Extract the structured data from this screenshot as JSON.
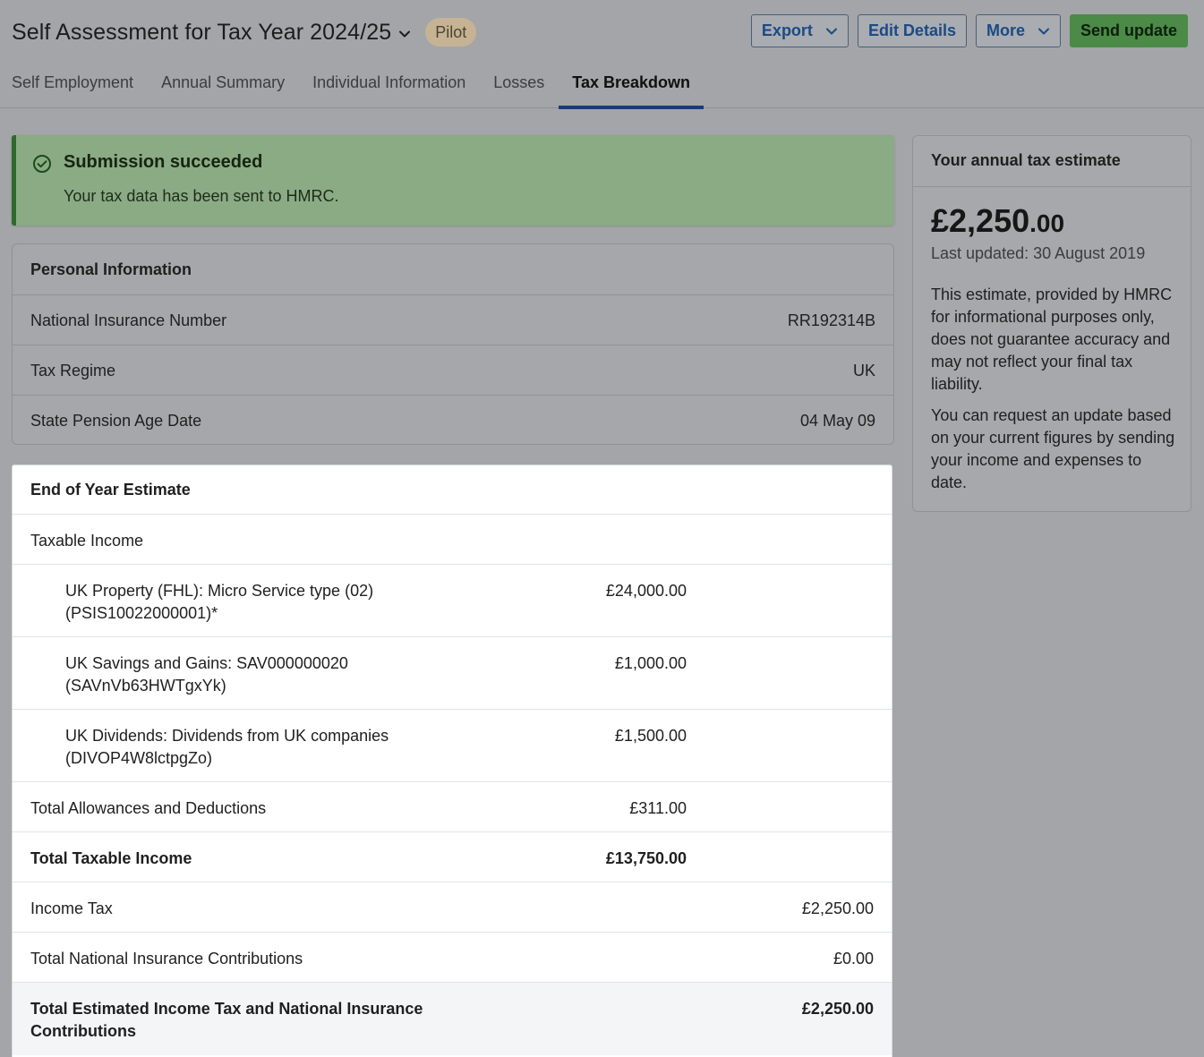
{
  "header": {
    "title": "Self Assessment for Tax Year 2024/25",
    "badge": "Pilot",
    "buttons": {
      "export": "Export",
      "edit_details": "Edit Details",
      "more": "More",
      "send_update": "Send update"
    },
    "tabs": [
      {
        "label": "Self Employment"
      },
      {
        "label": "Annual Summary"
      },
      {
        "label": "Individual Information"
      },
      {
        "label": "Losses"
      },
      {
        "label": "Tax Breakdown",
        "active": true
      }
    ]
  },
  "alert": {
    "title": "Submission succeeded",
    "message": "Your tax data has been sent to HMRC."
  },
  "personal": {
    "heading": "Personal Information",
    "rows": [
      {
        "label": "National Insurance Number",
        "value": "RR192314B"
      },
      {
        "label": "Tax Regime",
        "value": "UK"
      },
      {
        "label": "State Pension Age Date",
        "value": "04 May 09"
      }
    ]
  },
  "estimate": {
    "heading": "End of Year Estimate",
    "taxable_income_label": "Taxable Income",
    "income_items": [
      {
        "label": "UK Property (FHL): Micro Service type (02) (PSIS10022000001)*",
        "value": "£24,000.00"
      },
      {
        "label": "UK Savings and Gains: SAV000000020 (SAVnVb63HWTgxYk)",
        "value": "£1,000.00"
      },
      {
        "label": "UK Dividends: Dividends from UK companies (DIVOP4W8lctpgZo)",
        "value": "£1,500.00"
      }
    ],
    "allowances": {
      "label": "Total Allowances and Deductions",
      "value": "£311.00"
    },
    "total_taxable": {
      "label": "Total Taxable Income",
      "value": "£13,750.00"
    },
    "income_tax": {
      "label": "Income Tax",
      "value": "£2,250.00"
    },
    "nic": {
      "label": "Total National Insurance Contributions",
      "value": "£0.00"
    },
    "total_estimated": {
      "label": "Total Estimated Income Tax and National Insurance Contributions",
      "value": "£2,250.00"
    }
  },
  "sidebar": {
    "heading": "Your annual tax estimate",
    "amount_main": "£2,250",
    "amount_cents": ".00",
    "last_updated": "Last updated: 30 August 2019",
    "paragraph1": "This estimate, provided by HMRC for informational purposes only, does not guarantee accuracy and may not reflect your final tax liability.",
    "paragraph2": "You can request an update based on your current figures by sending your income and expenses to date."
  }
}
